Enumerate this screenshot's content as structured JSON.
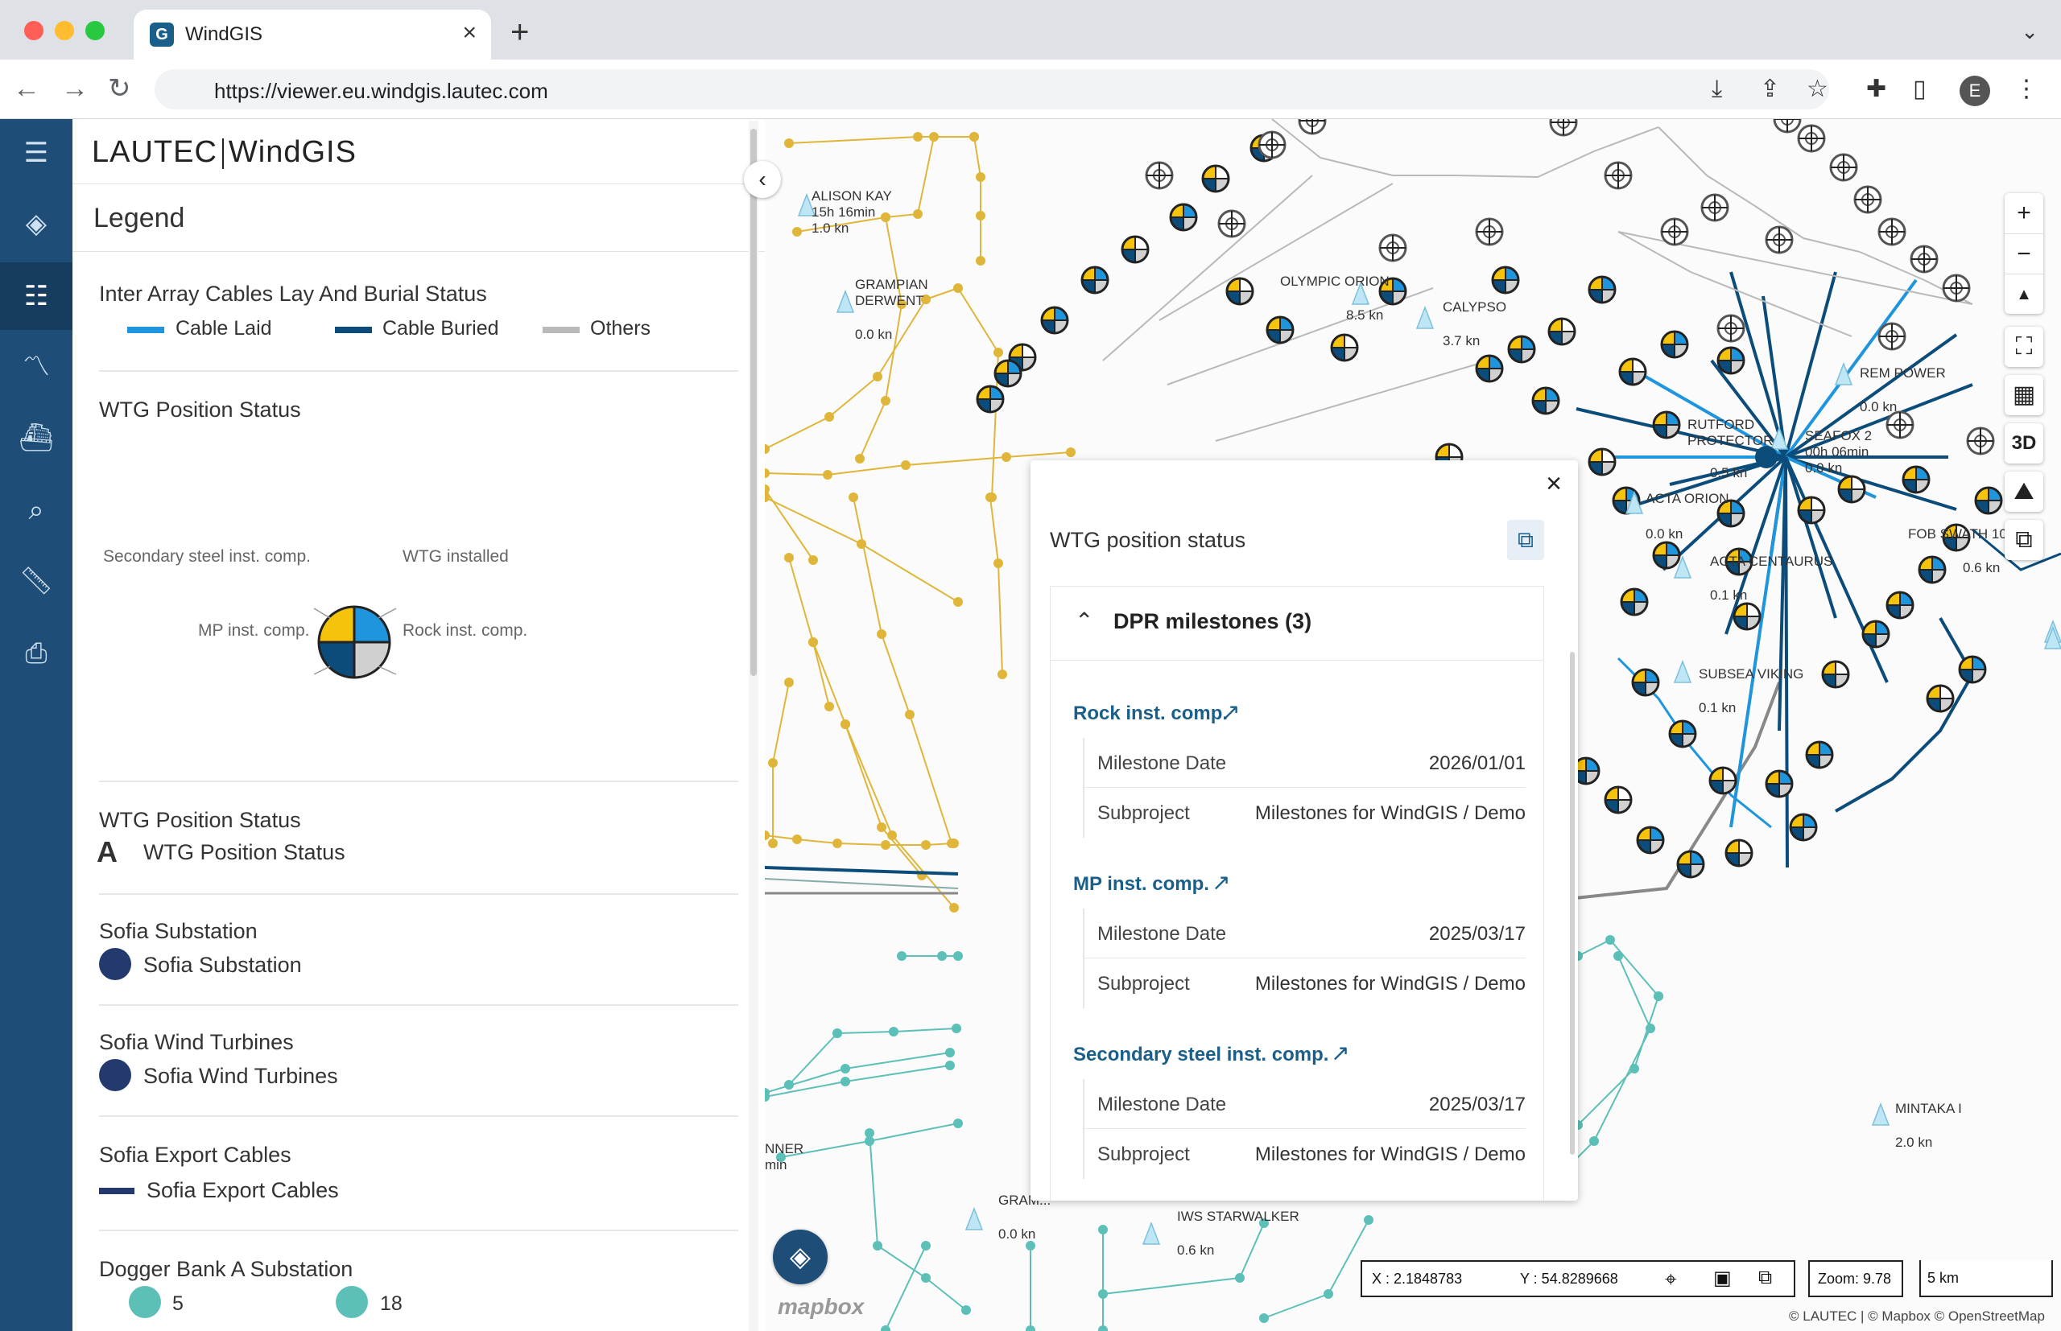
{
  "browser": {
    "tab_title": "WindGIS",
    "tab_favicon": "G",
    "url": "https://viewer.eu.windgis.lautec.com",
    "avatar_letter": "E"
  },
  "app": {
    "logo_left": "LAUTEC",
    "logo_right": "WindGIS",
    "legend_title": "Legend"
  },
  "legend": {
    "inter_array": {
      "title": "Inter Array Cables Lay And Burial Status",
      "items": [
        {
          "label": "Cable Laid",
          "color": "#1e95dc"
        },
        {
          "label": "Cable Buried",
          "color": "#0b4c7a"
        },
        {
          "label": "Others",
          "color": "#b9b9b9"
        }
      ]
    },
    "wtg_status": {
      "title": "WTG Position Status",
      "pie_labels": {
        "top_left": "Secondary steel inst. comp.",
        "top_right": "WTG installed",
        "bottom_left": "MP inst. comp.",
        "bottom_right": "Rock inst. comp."
      },
      "colors": {
        "yellow": "#f5c30b",
        "blue": "#1e95dc",
        "navy": "#0b4c7a",
        "grey": "#d0d0d0"
      }
    },
    "wtg_status_text": {
      "title": "WTG Position Status",
      "glyph": "A",
      "label": "WTG Position Status"
    },
    "sofia_substation": {
      "title": "Sofia Substation",
      "label": "Sofia Substation",
      "color": "#243a6e"
    },
    "sofia_turbines": {
      "title": "Sofia Wind Turbines",
      "label": "Sofia Wind Turbines",
      "color": "#243a6e"
    },
    "sofia_export": {
      "title": "Sofia Export Cables",
      "label": "Sofia Export Cables",
      "color": "#243a6e"
    },
    "dogger_substation": {
      "title": "Dogger Bank A Substation",
      "item1": "5",
      "item2": "18",
      "color": "#5cbfb8"
    }
  },
  "map": {
    "vessels": [
      {
        "name": "ALISON KAY\n15h 16min\n1.0 kn"
      },
      {
        "name": "GRAMPIAN\nDERWENT"
      },
      {
        "name": "0.0 kn"
      },
      {
        "name": "OLYMPIC ORION"
      },
      {
        "name": "8.5 kn"
      },
      {
        "name": "CALYPSO"
      },
      {
        "name": "3.7 kn"
      },
      {
        "name": "REM POWER"
      },
      {
        "name": "0.0 kn"
      },
      {
        "name": "RUTFORD\nPROTECTOR"
      },
      {
        "name": "SEAFOX 2\n00h 06min\n0.0 kn"
      },
      {
        "name": "0.5 kn"
      },
      {
        "name": "ACTA ORION"
      },
      {
        "name": "0.0 kn"
      },
      {
        "name": "FOB SWATH 10"
      },
      {
        "name": "0.6 kn"
      },
      {
        "name": "ACTA CENTAURUS"
      },
      {
        "name": "0.1 kn"
      },
      {
        "name": "SUBSEA VIKING"
      },
      {
        "name": "0.1 kn"
      },
      {
        "name": "MINTAKA I"
      },
      {
        "name": "2.0 kn"
      },
      {
        "name": "NNER\nmin"
      },
      {
        "name": "GRAM..."
      },
      {
        "name": "0.0 kn"
      },
      {
        "name": "IWS STARWALKER"
      },
      {
        "name": "0.6 kn"
      }
    ],
    "controls": {
      "zoom_in": "+",
      "zoom_out": "−",
      "compass": "▲",
      "fullscreen": "⛶",
      "basemap": "▦",
      "three_d": "3D",
      "terrain": "⛰",
      "copy": "⧉"
    },
    "coords": {
      "x": "X : 2.1848783",
      "y": "Y : 54.8289668"
    },
    "zoom": "Zoom: 9.78",
    "scale": "5 km",
    "attribution": "© LAUTEC | © Mapbox © OpenStreetMap",
    "mapbox": "mapbox"
  },
  "popup": {
    "title": "WTG position status",
    "accordion_title": "DPR milestones (3)",
    "milestones": [
      {
        "title": "Rock inst. comp.",
        "date_key": "Milestone Date",
        "date": "2026/01/01",
        "sub_key": "Subproject",
        "sub": "Milestones for WindGIS / Demo"
      },
      {
        "title": "MP inst. comp.",
        "date_key": "Milestone Date",
        "date": "2025/03/17",
        "sub_key": "Subproject",
        "sub": "Milestones for WindGIS / Demo"
      },
      {
        "title": "Secondary steel inst. comp.",
        "date_key": "Milestone Date",
        "date": "2025/03/17",
        "sub_key": "Subproject",
        "sub": "Milestones for WindGIS / Demo"
      }
    ]
  }
}
